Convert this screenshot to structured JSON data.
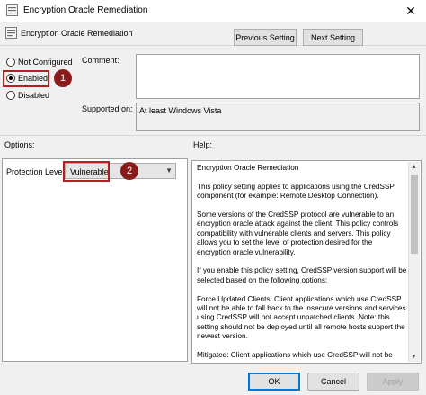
{
  "window": {
    "title": "Encryption Oracle Remediation",
    "close_glyph": "✕"
  },
  "header": {
    "policy_name": "Encryption Oracle Remediation",
    "previous_label": "Previous Setting",
    "next_label": "Next Setting"
  },
  "state": {
    "options": [
      {
        "label": "Not Configured",
        "selected": false
      },
      {
        "label": "Enabled",
        "selected": true
      },
      {
        "label": "Disabled",
        "selected": false
      }
    ]
  },
  "meta": {
    "comment_label": "Comment:",
    "supported_label": "Supported on:",
    "supported_value": "At least Windows Vista"
  },
  "sections": {
    "options_label": "Options:",
    "help_label": "Help:"
  },
  "options": {
    "protection_label": "Protection Level:",
    "protection_value": "Vulnerable",
    "dropdown_glyph": "▼"
  },
  "annotations": {
    "badge1": "1",
    "badge2": "2",
    "accent_color": "#b22020"
  },
  "help": {
    "paragraphs": [
      "Encryption Oracle Remediation",
      "This policy setting applies to applications using the CredSSP component (for example: Remote Desktop Connection).",
      "Some versions of the CredSSP protocol are vulnerable to an encryption oracle attack against the client. This policy controls compatibility with vulnerable clients and servers. This policy allows you to set the level of protection desired for the encryption oracle vulnerability.",
      "If you enable this policy setting, CredSSP version support will be selected based on the following options:",
      "Force Updated Clients: Client applications which use CredSSP will not be able to fall back to the insecure versions and services using CredSSP will not accept unpatched clients. Note: this setting should not be deployed until all remote hosts support the newest version.",
      "Mitigated: Client applications which use CredSSP will not be able"
    ]
  },
  "footer": {
    "ok_label": "OK",
    "cancel_label": "Cancel",
    "apply_label": "Apply"
  }
}
